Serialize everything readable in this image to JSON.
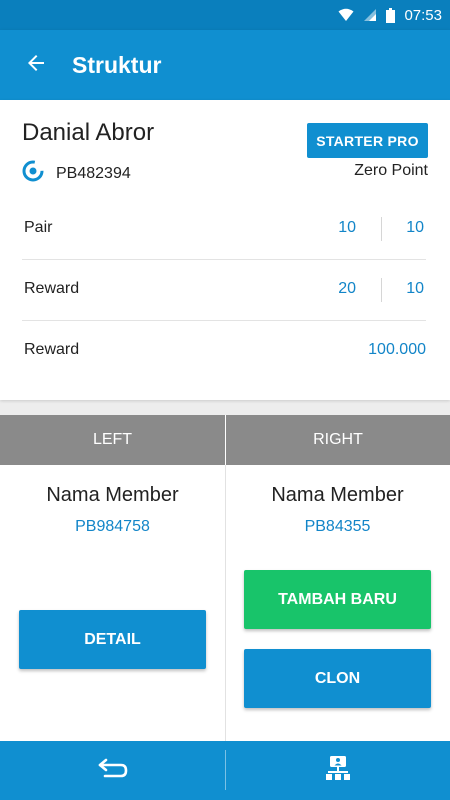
{
  "status_bar": {
    "time": "07:53"
  },
  "app_bar": {
    "title": "Struktur"
  },
  "profile": {
    "name": "Danial Abror",
    "plan": "STARTER PRO",
    "id": "PB482394",
    "rank": "Zero Point"
  },
  "stats": [
    {
      "label": "Pair",
      "left": "10",
      "right": "10"
    },
    {
      "label": "Reward",
      "left": "20",
      "right": "10"
    },
    {
      "label": "Reward",
      "value": "100.000"
    }
  ],
  "tabs": {
    "left": "LEFT",
    "right": "RIGHT"
  },
  "left_member": {
    "name": "Nama Member",
    "id": "PB984758",
    "detail_label": "DETAIL"
  },
  "right_member": {
    "name": "Nama Member",
    "id": "PB84355",
    "add_label": "TAMBAH BARU",
    "clone_label": "CLON"
  },
  "colors": {
    "primary": "#108fd0",
    "green": "#18c46a",
    "tab_gray": "#8a8a8a",
    "value_blue": "#1285c8"
  },
  "icons": {
    "status": [
      "wifi-icon",
      "signal-icon",
      "battery-icon"
    ],
    "back": "arrow-left-icon",
    "id_badge": "target-icon",
    "nav": [
      "return-icon",
      "network-structure-icon"
    ]
  }
}
